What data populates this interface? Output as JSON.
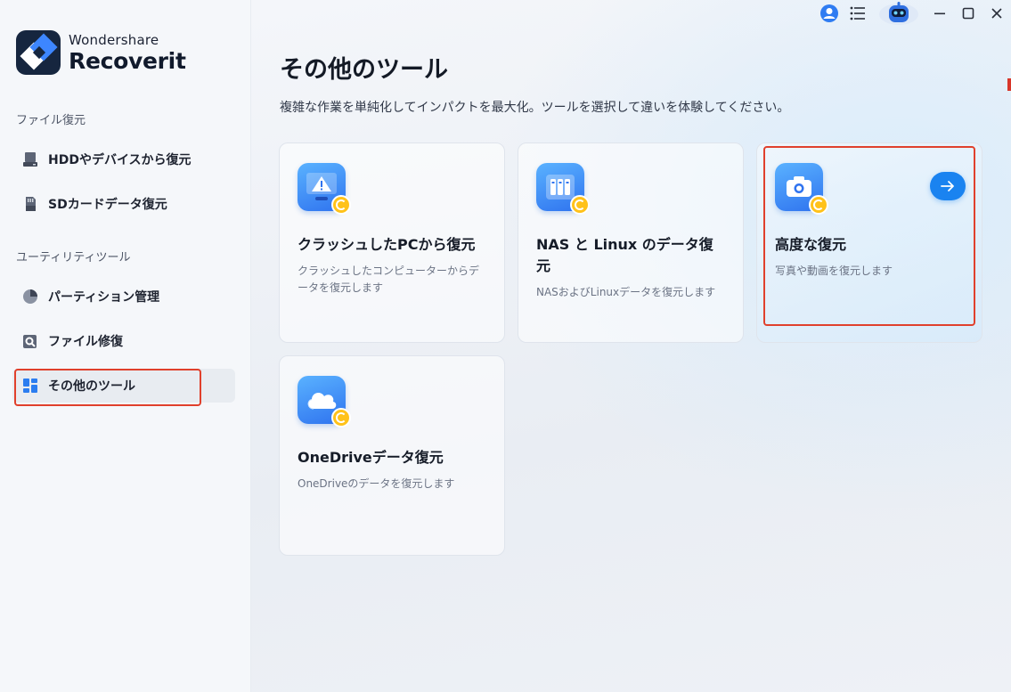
{
  "brand": {
    "company": "Wondershare",
    "product": "Recoverit"
  },
  "sidebar": {
    "section_file_recovery": "ファイル復元",
    "section_utilities": "ユーティリティツール",
    "items": [
      {
        "label": "HDDやデバイスから復元",
        "icon": "hard-drive-icon"
      },
      {
        "label": "SDカードデータ復元",
        "icon": "sd-card-icon"
      },
      {
        "label": "パーティション管理",
        "icon": "pie-chart-icon"
      },
      {
        "label": "ファイル修復",
        "icon": "file-repair-icon"
      },
      {
        "label": "その他のツール",
        "icon": "grid-icon",
        "active": true
      }
    ]
  },
  "titlebar": {
    "icons": [
      "user-avatar-icon",
      "menu-list-icon",
      "robot-assistant-icon",
      "minimize-icon",
      "maximize-icon",
      "close-icon"
    ]
  },
  "main": {
    "title": "その他のツール",
    "subtitle": "複雑な作業を単純化してインパクトを最大化。ツールを選択して違いを体験してください。",
    "cards": [
      {
        "title": "クラッシュしたPCから復元",
        "desc": "クラッシュしたコンピューターからデータを復元します",
        "icon": "crashed-pc-icon"
      },
      {
        "title": "NAS と Linux のデータ復元",
        "desc": "NASおよびLinuxデータを復元します",
        "icon": "nas-server-icon"
      },
      {
        "title": "高度な復元",
        "desc": "写真や動画を復元します",
        "icon": "camera-icon"
      },
      {
        "title": "OneDriveデータ復元",
        "desc": "OneDriveのデータを復元します",
        "icon": "cloud-icon"
      }
    ]
  },
  "colors": {
    "accent": "#1a83f0",
    "highlight": "#e0402c",
    "badge": "#ffc21a"
  }
}
